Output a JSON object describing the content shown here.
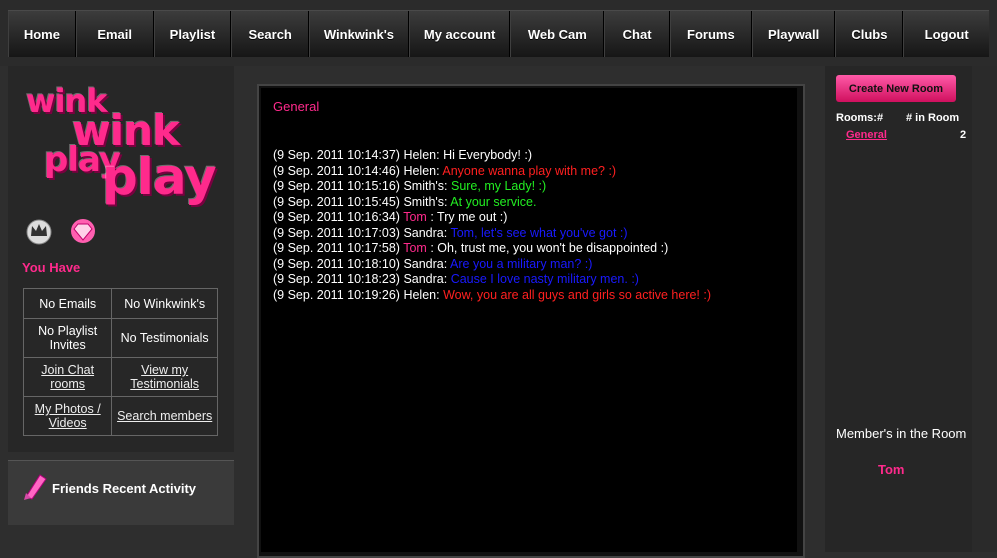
{
  "nav": {
    "items": [
      "Home",
      "Email",
      "Playlist",
      "Search",
      "Winkwink's",
      "My account",
      "Web Cam",
      "Chat",
      "Forums",
      "Playwall",
      "Clubs",
      "Logout"
    ]
  },
  "logo": {
    "line1": "wink",
    "line2": "wink",
    "line3": "play",
    "line4": "play"
  },
  "sidebar": {
    "you_have": "You Have",
    "grid": [
      [
        "No Emails",
        "No Winkwink's"
      ],
      [
        "No Playlist Invites",
        "No Testimonials"
      ],
      [
        "Join Chat rooms",
        "View my Testimonials"
      ],
      [
        "My Photos / Videos",
        "Search members"
      ]
    ],
    "friends_label": "Friends Recent Activity"
  },
  "chat": {
    "room_title": "General",
    "messages": [
      {
        "time": "(9 Sep. 2011 10:14:37)",
        "user": "Helen:",
        "text": "Hi Everybody! :)",
        "user_color": "#ffffff",
        "text_color": "#ffffff"
      },
      {
        "time": "(9 Sep. 2011 10:14:46)",
        "user": "Helen:",
        "text": "Anyone wanna play with me? :)",
        "user_color": "#ffffff",
        "text_color": "#ff2020"
      },
      {
        "time": "(9 Sep. 2011 10:15:16)",
        "user": "Smith's:",
        "text": "Sure, my Lady! :)",
        "user_color": "#ffffff",
        "text_color": "#22ee22"
      },
      {
        "time": "(9 Sep. 2011 10:15:45)",
        "user": "Smith's:",
        "text": "At your service.",
        "user_color": "#ffffff",
        "text_color": "#22ee22"
      },
      {
        "time": "(9 Sep. 2011 10:16:34)",
        "user": "Tom",
        "text": ": Try me out :)",
        "user_color": "#ff2a8c",
        "text_color": "#ffffff"
      },
      {
        "time": "(9 Sep. 2011 10:17:03)",
        "user": "Sandra:",
        "text": "Tom, let's see what you've got :)",
        "user_color": "#ffffff",
        "text_color": "#1a1aff"
      },
      {
        "time": "(9 Sep. 2011 10:17:58)",
        "user": "Tom",
        "text": ": Oh, trust me, you won't be disappointed :)",
        "user_color": "#ff2a8c",
        "text_color": "#ffffff"
      },
      {
        "time": "(9 Sep. 2011 10:18:10)",
        "user": "Sandra:",
        "text": "Are you a military man? :)",
        "user_color": "#ffffff",
        "text_color": "#1a1aff"
      },
      {
        "time": "(9 Sep. 2011 10:18:23)",
        "user": "Sandra:",
        "text": "Cause I love nasty military men. :)",
        "user_color": "#ffffff",
        "text_color": "#1a1aff"
      },
      {
        "time": "(9 Sep. 2011 10:19:26)",
        "user": "Helen:",
        "text": "Wow, you are all guys and girls so active here! :)",
        "user_color": "#ffffff",
        "text_color": "#ff2020"
      }
    ]
  },
  "rooms": {
    "create_button": "Create New Room",
    "header_rooms": "Rooms:#",
    "header_count": "# in Room",
    "list": [
      {
        "name": "General",
        "count": "2"
      }
    ],
    "members_heading": "Member's in the Room",
    "members": [
      "Tom"
    ]
  },
  "colors": {
    "accent": "#ff2a8c",
    "background": "#2e2e2e",
    "chat_bg": "#000000"
  },
  "icons": {
    "badge1": "crown-icon",
    "badge2": "diamond-icon",
    "friends": "pink-ribbon-icon"
  }
}
